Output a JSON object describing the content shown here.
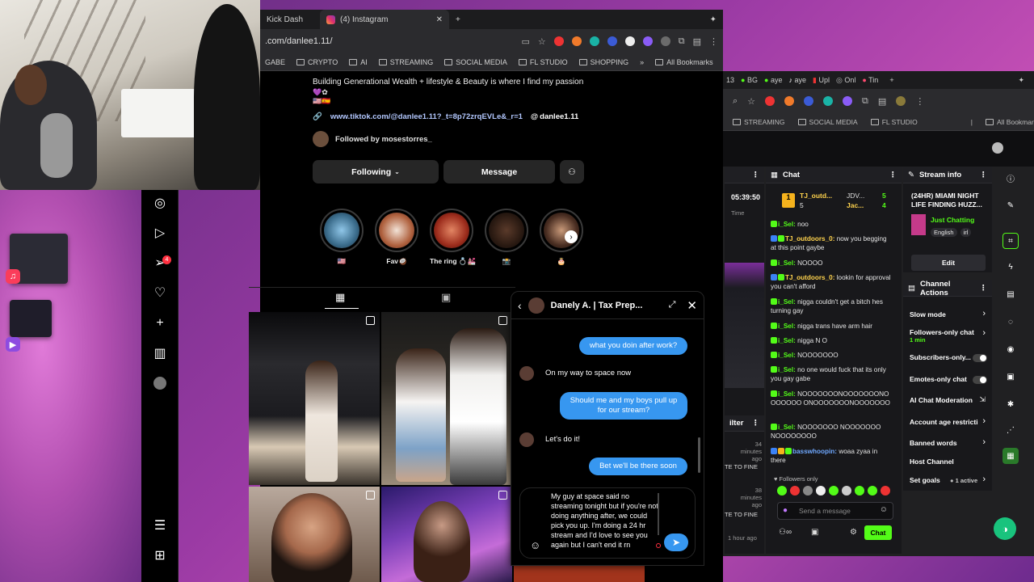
{
  "main_browser": {
    "tabs": [
      {
        "label": "Kick Dash",
        "active": false
      },
      {
        "label": "(4) Instagram",
        "active": true
      }
    ],
    "url": ".com/danlee1.11/",
    "bookmarks": [
      "GABE",
      "CRYPTO",
      "AI",
      "STREAMING",
      "SOCIAL MEDIA",
      "FL STUDIO",
      "SHOPPING"
    ],
    "all_bookmarks": "All Bookmarks"
  },
  "profile": {
    "bio": "Building Generational Wealth + lifestyle & Beauty is where I find my passion",
    "bio_emoji_line1": "💜✿",
    "bio_emoji_line2": "🇺🇸🇪🇸",
    "link": "www.tiktok.com/@danlee1.11?_t=8p72zrqEVLe&_r=1",
    "threads_handle": "danlee1.11",
    "followed_by": "Followed by mosestorres_",
    "following_button": "Following",
    "message_button": "Message",
    "highlights": [
      {
        "label": "🇺🇸"
      },
      {
        "label": "Fav🥥"
      },
      {
        "label": "The ring 💍💒"
      },
      {
        "label": "📸"
      },
      {
        "label": "🎂"
      }
    ]
  },
  "dm": {
    "contact_name": "Danely A. | Tax Prep...",
    "messages": [
      {
        "dir": "out",
        "text": "what you doin after work?"
      },
      {
        "dir": "in",
        "text": "On my way to space now"
      },
      {
        "dir": "out",
        "text": "Should me and my boys pull up for our stream?"
      },
      {
        "dir": "in",
        "text": "Let's do it!"
      },
      {
        "dir": "out",
        "text": "Bet we'll be there soon"
      }
    ],
    "draft": "My guy at space said no streaming tonight but if you're not doing anything after, we could pick you up. I'm doing a 24 hr stream and I'd love to see you again but I can't end it rn"
  },
  "right_browser": {
    "tabs": [
      "13",
      "BG",
      "aye",
      "aye",
      "Upl",
      "Onl",
      "Tin"
    ],
    "bookmarks": [
      "STREAMING",
      "SOCIAL MEDIA",
      "FL STUDIO"
    ],
    "all_bookmarks": "All Bookmarks",
    "timer": "05:39:50",
    "time_label": "Time",
    "filter_label": "ilter",
    "minutes_ago_1": "34 minutes ago",
    "minutes_ago_2": "38 minutes ago",
    "hour_ago": "1 hour ago",
    "te_to_fine_1": "TE TO FINE",
    "te_to_fine_2": "TE TO FINE"
  },
  "chat": {
    "title": "Chat",
    "leaders": [
      {
        "rank": "1",
        "name": "TJ_outd...",
        "count": "5"
      },
      {
        "name": "JDV...",
        "count": "5"
      },
      {
        "name": "Jac...",
        "count": "4"
      }
    ],
    "lines": [
      {
        "user": "i_Sel:",
        "text": "noo"
      },
      {
        "user": "TJ_outdoors_0:",
        "text": "now you begging at this point gaybe"
      },
      {
        "user": "i_Sel:",
        "text": "NOOOO"
      },
      {
        "user": "TJ_outdoors_0:",
        "text": "lookin for approval you can't afford"
      },
      {
        "user": "i_Sel:",
        "text": "nigga couldn't get a bitch hes turning gay"
      },
      {
        "user": "i_Sel:",
        "text": "nigga trans have arm hair"
      },
      {
        "user": "i_Sel:",
        "text": "nigga N O"
      },
      {
        "user": "i_Sel:",
        "text": "NOOOOOOO"
      },
      {
        "user": "i_Sel:",
        "text": "no one would fuck that its only you gay gabe"
      },
      {
        "user": "i_Sel:",
        "text": "NOOOOOOONOOOOOOONOOOOOOO ONOOOOOOONOOOOOOO"
      },
      {
        "user": "i_Sel:",
        "text": "NOOOOOOO NOOOOOOO NOOOOOOOO"
      },
      {
        "user": "basswhoopin:",
        "text": "woaa zyaa in there"
      }
    ],
    "followers_only": "Followers only",
    "placeholder": "Send a message",
    "send": "Chat"
  },
  "stream_info": {
    "title": "Stream info",
    "stream_title": "(24HR) MIAMI NIGHT LIFE FINDING HUZZ...",
    "category": "Just Chatting",
    "tags": [
      "English",
      "irl"
    ],
    "edit": "Edit"
  },
  "channel_actions": {
    "title": "Channel Actions",
    "items": [
      {
        "label": "Slow mode"
      },
      {
        "label": "Followers-only chat",
        "sub": "1 min"
      },
      {
        "label": "Subscribers-only..."
      },
      {
        "label": "Emotes-only chat"
      },
      {
        "label": "AI Chat Moderation"
      },
      {
        "label": "Account age restricti"
      },
      {
        "label": "Banned words"
      },
      {
        "label": "Host Channel"
      },
      {
        "label": "Set goals",
        "sub": "1 active"
      }
    ]
  },
  "colors": {
    "ig_blue": "#3797f0",
    "kick_green": "#53fc18",
    "notif_red": "#ff3040"
  },
  "sidebar_badge": "4"
}
